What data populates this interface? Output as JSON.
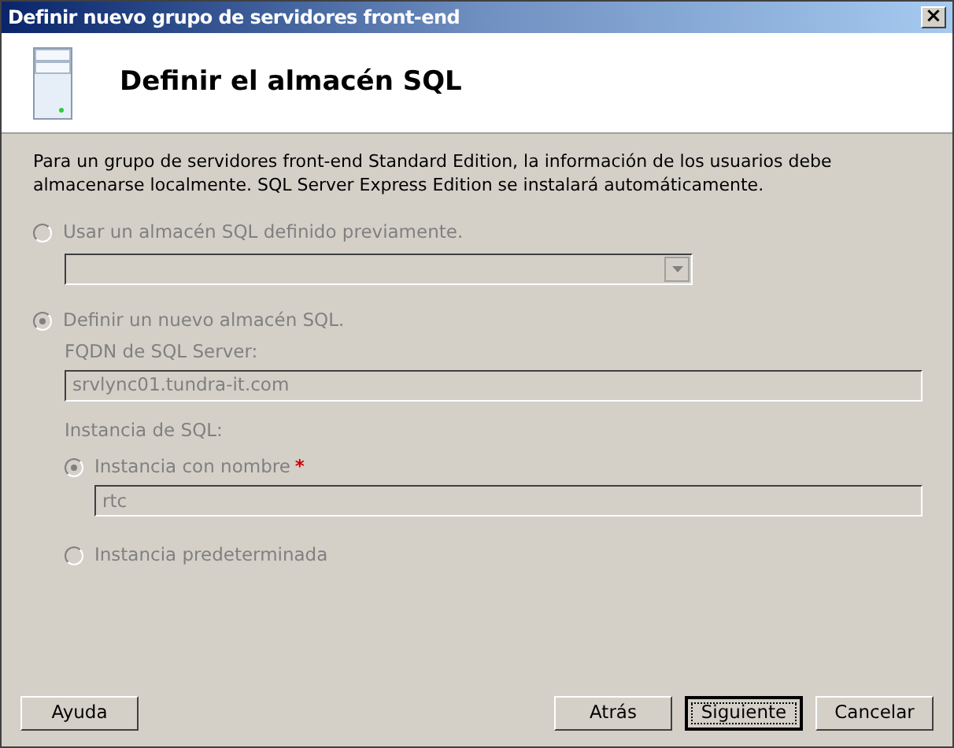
{
  "window": {
    "title": "Definir nuevo grupo de servidores front-end",
    "close": "×"
  },
  "header": {
    "title": "Definir el almacén SQL"
  },
  "description": "Para un grupo de servidores front-end Standard Edition, la información de los usuarios debe almacenarse localmente. SQL Server Express Edition se instalará automáticamente.",
  "store_options": [
    {
      "label": "Usar un almacén SQL definido previamente.",
      "selected": false,
      "disabled": true,
      "kind": "dropdown"
    },
    {
      "label": "Definir un nuevo almacén SQL.",
      "selected": true,
      "disabled": true,
      "kind": "fqdn",
      "field_label": "FQDN de SQL Server:",
      "value": "srvlync01.tundra-it.com"
    }
  ],
  "instance": {
    "label": "Instancia de SQL:",
    "options": [
      {
        "label": "Instancia con nombre",
        "required_mark": "*",
        "selected": true,
        "disabled": true,
        "value": "rtc"
      },
      {
        "label": "Instancia predeterminada",
        "selected": false,
        "disabled": true
      }
    ]
  },
  "help_button": {
    "label": "Ayuda",
    "focused": false
  },
  "buttons": [
    {
      "label": "Atrás",
      "focused": false
    },
    {
      "label": "Siguiente",
      "focused": true
    },
    {
      "label": "Cancelar",
      "focused": false
    }
  ]
}
